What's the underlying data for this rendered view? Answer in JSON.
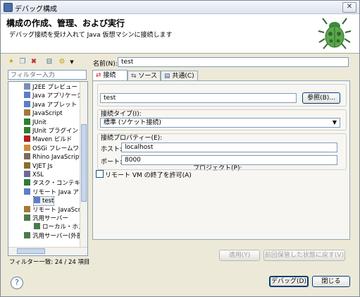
{
  "window": {
    "title": "デバッグ構成",
    "close": "✕"
  },
  "header": {
    "title": "構成の作成、管理、および実行",
    "subtitle": "デバッグ接続を受け入れて Java 仮想マシンに接続します"
  },
  "left": {
    "filter_placeholder": "フィルター入力",
    "tree": [
      {
        "label": "J2EE プレビュー",
        "icon": "j2ee-preview-icon",
        "color": "#7a8fb5"
      },
      {
        "label": "Java アプリケーション",
        "icon": "java-application-icon",
        "color": "#5b7fc7"
      },
      {
        "label": "Java アプレット",
        "icon": "java-applet-icon",
        "color": "#5b7fc7"
      },
      {
        "label": "JavaScript",
        "icon": "javascript-icon",
        "color": "#a07a3a"
      },
      {
        "label": "JUnit",
        "icon": "junit-icon",
        "color": "#2e7d32"
      },
      {
        "label": "JUnit プラグイン・テスト",
        "icon": "junit-plugin-icon",
        "color": "#2e7d32"
      },
      {
        "label": "Maven ビルド",
        "icon": "maven-icon",
        "color": "#b71c1c"
      },
      {
        "label": "OSGi フレームワーク",
        "icon": "osgi-icon",
        "color": "#d08a3a"
      },
      {
        "label": "Rhino JavaScript",
        "icon": "rhino-icon",
        "color": "#7a6a5a"
      },
      {
        "label": "VJET Js",
        "icon": "vjet-icon",
        "color": "#8a6d2a"
      },
      {
        "label": "XSL",
        "icon": "xsl-icon",
        "color": "#6a6a9a"
      },
      {
        "label": "タスク・コンテキスト",
        "icon": "task-context-icon",
        "color": "#2e7d32"
      },
      {
        "label": "リモート Java アプリケーション",
        "icon": "remote-java-icon",
        "color": "#5b7fc7"
      },
      {
        "label": "test",
        "icon": "config-icon",
        "color": "#5b7fc7"
      },
      {
        "label": "リモート JavaScript",
        "icon": "remote-javascript-icon",
        "color": "#a07a3a"
      },
      {
        "label": "汎用サーバー",
        "icon": "generic-server-icon",
        "color": "#4a7a4a"
      },
      {
        "label": "ローカル・ホスト",
        "icon": "local-host-icon",
        "color": "#4a7a4a"
      },
      {
        "label": "汎用サーバー(外部)",
        "icon": "generic-server-ext-icon",
        "color": "#4a7a4a"
      }
    ],
    "status": "フィルター一致: 24 / 24 項目"
  },
  "right": {
    "name_label": "名前(N):",
    "name_value": "test",
    "tabs": [
      {
        "label": "接続",
        "icon": "connect-icon"
      },
      {
        "label": "ソース",
        "icon": "source-icon"
      },
      {
        "label": "共通(C)",
        "icon": "common-icon"
      }
    ],
    "project_label": "プロジェクト(P):",
    "project_value": "test",
    "browse_button": "参照(B)...",
    "conn_type_label": "接続タイプ(I):",
    "conn_type_value": "標準 (ソケット接続)",
    "conn_props_label": "接続プロパティー(E):",
    "host_label": "ホスト:",
    "host_value": "localhost",
    "port_label": "ポート:",
    "port_value": "8000",
    "allow_terminate": "リモート VM の終了を許可(A)",
    "apply_button": "適用(Y)",
    "revert_button": "前回保管した状態に戻す(V)"
  },
  "footer": {
    "debug_button": "デバッグ(D)",
    "close_button": "閉じる"
  }
}
